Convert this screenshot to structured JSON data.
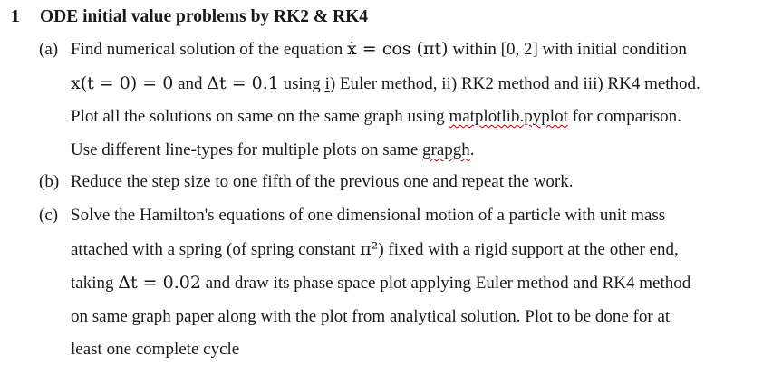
{
  "heading": {
    "number": "1",
    "title": "ODE initial value problems by RK2 & RK4"
  },
  "part_a": {
    "label": "(a)",
    "l1_pre": "Find numerical solution of the equation",
    "l1_eq": "ẋ = cos (πt)",
    "l1_post": "within [0, 2] with initial condition",
    "l2_eq": "x(t = 0) = 0",
    "l2_and": "and",
    "l2_dt": "Δt = 0.1",
    "l2_using": "using",
    "l2_i": "i",
    "l2_post": ") Euler method, ii) RK2 method and iii) RK4 method.",
    "l3_pre": "Plot all the solutions on same on the same graph using",
    "l3_lib": "matplotlib.pyplot",
    "l3_post": "for comparison.",
    "l4_pre": "Use different line-types for multiple plots on same",
    "l4_word": "grapgh",
    "l4_post": "."
  },
  "part_b": {
    "label": "(b)",
    "text": "Reduce the step size to one fifth of the previous one and repeat the work."
  },
  "part_c": {
    "label": "(c)",
    "l1": "Solve the Hamilton's equations of one dimensional motion of a particle with unit mass",
    "l2_pre": "attached with a spring (of spring constant",
    "l2_eq": "π²",
    "l2_post": ") fixed with a rigid support at the other end,",
    "l3_pre": "taking",
    "l3_eq": "Δt = 0.02",
    "l3_post": "and draw its phase space plot applying Euler method and RK4 method",
    "l4": "on same graph paper along with the plot from analytical solution. Plot to be done for at",
    "l5": "least one complete cycle"
  }
}
